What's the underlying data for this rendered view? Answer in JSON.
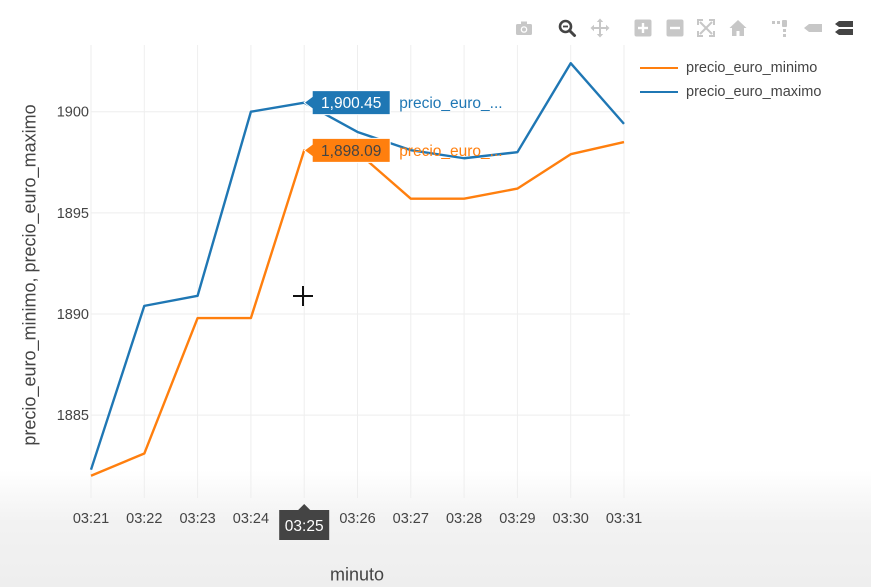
{
  "toolbar": [
    {
      "name": "camera-icon",
      "title": "Download plot as a png"
    },
    {
      "name": "zoom-icon",
      "title": "Zoom"
    },
    {
      "name": "pan-icon",
      "title": "Pan"
    },
    {
      "name": "zoom-in-icon",
      "title": "Zoom in"
    },
    {
      "name": "zoom-out-icon",
      "title": "Zoom out"
    },
    {
      "name": "autoscale-icon",
      "title": "Autoscale"
    },
    {
      "name": "home-icon",
      "title": "Reset axes"
    },
    {
      "name": "spike-lines-icon",
      "title": "Toggle Spike Lines"
    },
    {
      "name": "hover-closest-icon",
      "title": "Show closest data on hover"
    },
    {
      "name": "hover-compare-icon",
      "title": "Compare data on hover"
    }
  ],
  "colors": {
    "minimo": "#ff7f0e",
    "maximo": "#1f77b4",
    "grid": "#eeeeee",
    "axis_text": "#444444",
    "active_icon": "#444444",
    "icon": "#c7c7c7"
  },
  "chart_data": {
    "type": "line",
    "xlabel": "minuto",
    "ylabel": "precio_euro_minimo, precio_euro_maximo",
    "x": [
      "03:21",
      "03:22",
      "03:23",
      "03:24",
      "03:25",
      "03:26",
      "03:27",
      "03:28",
      "03:29",
      "03:30",
      "03:31"
    ],
    "ylim": [
      1880.9,
      1903.3
    ],
    "yticks": [
      1885,
      1890,
      1895,
      1900
    ],
    "grid": true,
    "legend_position": "top-right",
    "series": [
      {
        "name": "precio_euro_minimo",
        "color": "#ff7f0e",
        "values": [
          1882.0,
          1883.1,
          1889.8,
          1889.8,
          1898.09,
          1898.0,
          1895.7,
          1895.7,
          1896.2,
          1897.9,
          1898.5
        ]
      },
      {
        "name": "precio_euro_maximo",
        "color": "#1f77b4",
        "values": [
          1882.3,
          1890.4,
          1890.9,
          1900.0,
          1900.45,
          1899.0,
          1898.1,
          1897.7,
          1898.0,
          1902.4,
          1899.4
        ]
      }
    ],
    "hover": {
      "x_label": "03:25",
      "labels": [
        {
          "value": "1,900.45",
          "series": "precio_euro_..."
        },
        {
          "value": "1,898.09",
          "series": "precio_euro_..."
        }
      ]
    }
  }
}
